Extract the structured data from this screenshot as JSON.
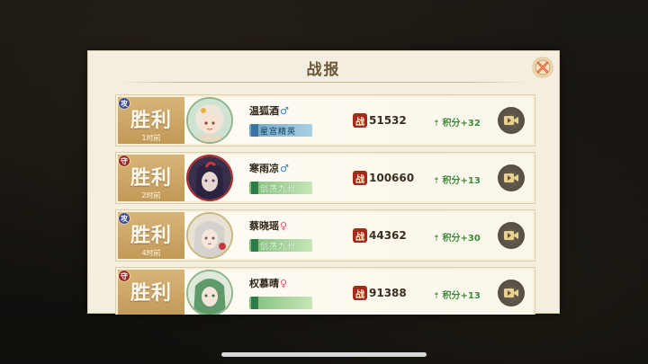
{
  "dialog": {
    "title": "战报"
  },
  "colors": {
    "victory_panel": "#c9a463",
    "score_up": "#3c8a3a",
    "power_icon": "#a52b1d"
  },
  "rows": [
    {
      "role": "攻",
      "role_type": "attack",
      "result": "胜利",
      "time": "1时前",
      "name": "温狐酒",
      "gender_symbol": "♂",
      "gender": "male",
      "tag": "星宫精英",
      "tag_style": "blue",
      "power_icon": "战",
      "power": "51532",
      "score": "积分+32",
      "avatar_icon": "avatar-white-hair-icon",
      "replay_icon": "replay-camera-icon"
    },
    {
      "role": "守",
      "role_type": "defend",
      "result": "胜利",
      "time": "2时前",
      "name": "寒雨凉",
      "gender_symbol": "♂",
      "gender": "male",
      "tag": "剑荡九州",
      "tag_style": "green",
      "power_icon": "战",
      "power": "100660",
      "score": "积分+13",
      "avatar_icon": "avatar-dark-hair-icon",
      "replay_icon": "replay-camera-icon"
    },
    {
      "role": "攻",
      "role_type": "attack",
      "result": "胜利",
      "time": "4时前",
      "name": "蔡晓瑶",
      "gender_symbol": "♀",
      "gender": "female",
      "tag": "剑荡九州",
      "tag_style": "green",
      "power_icon": "战",
      "power": "44362",
      "score": "积分+30",
      "avatar_icon": "avatar-silver-hair-icon",
      "replay_icon": "replay-camera-icon"
    },
    {
      "role": "守",
      "role_type": "defend",
      "result": "胜利",
      "time": "",
      "name": "权慕晴",
      "gender_symbol": "♀",
      "gender": "female",
      "tag": "",
      "tag_style": "green",
      "power_icon": "战",
      "power": "91388",
      "score": "积分+13",
      "avatar_icon": "avatar-green-hair-icon",
      "replay_icon": "replay-camera-icon"
    }
  ]
}
